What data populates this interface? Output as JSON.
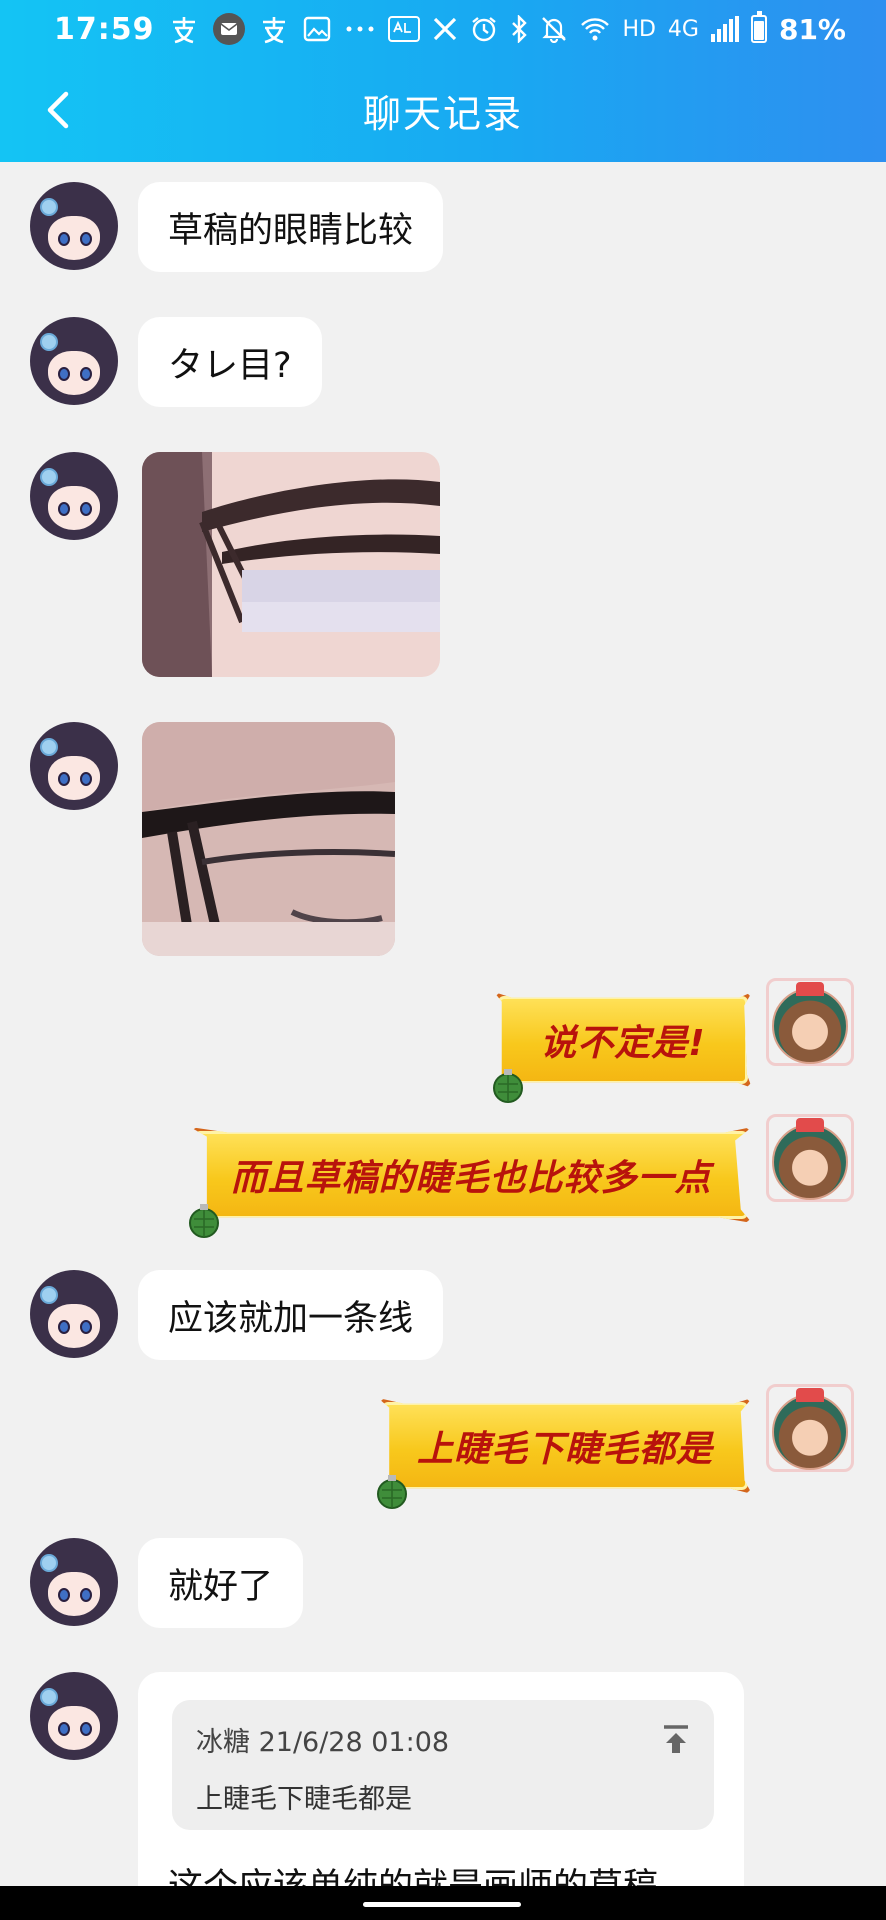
{
  "status_bar": {
    "time": "17:59",
    "network": "HD",
    "cell": "4G",
    "battery": "81%"
  },
  "header": {
    "title": "聊天记录"
  },
  "messages": {
    "m1": "草稿的眼睛比较",
    "m2": "タレ目?",
    "m5": "说不定是!",
    "m6": "而且草稿的睫毛也比较多一点",
    "m7": "应该就加一条线",
    "m8": "上睫毛下睫毛都是",
    "m9": "就好了"
  },
  "quote": {
    "meta": "冰糖 21/6/28 01:08",
    "text": "上睫毛下睫毛都是",
    "body": "这个应该单纯的就是画师的草稿"
  },
  "colors": {
    "header_start": "#14c4f4",
    "header_end": "#2e8ff0",
    "background": "#f1f1f1",
    "fancy_text": "#b8130c",
    "fancy_fill": "#f8c81c"
  },
  "icons": {
    "back": "chevron-left-icon",
    "quote_pin": "pin-to-top-icon",
    "grenade": "grenade-icon"
  }
}
